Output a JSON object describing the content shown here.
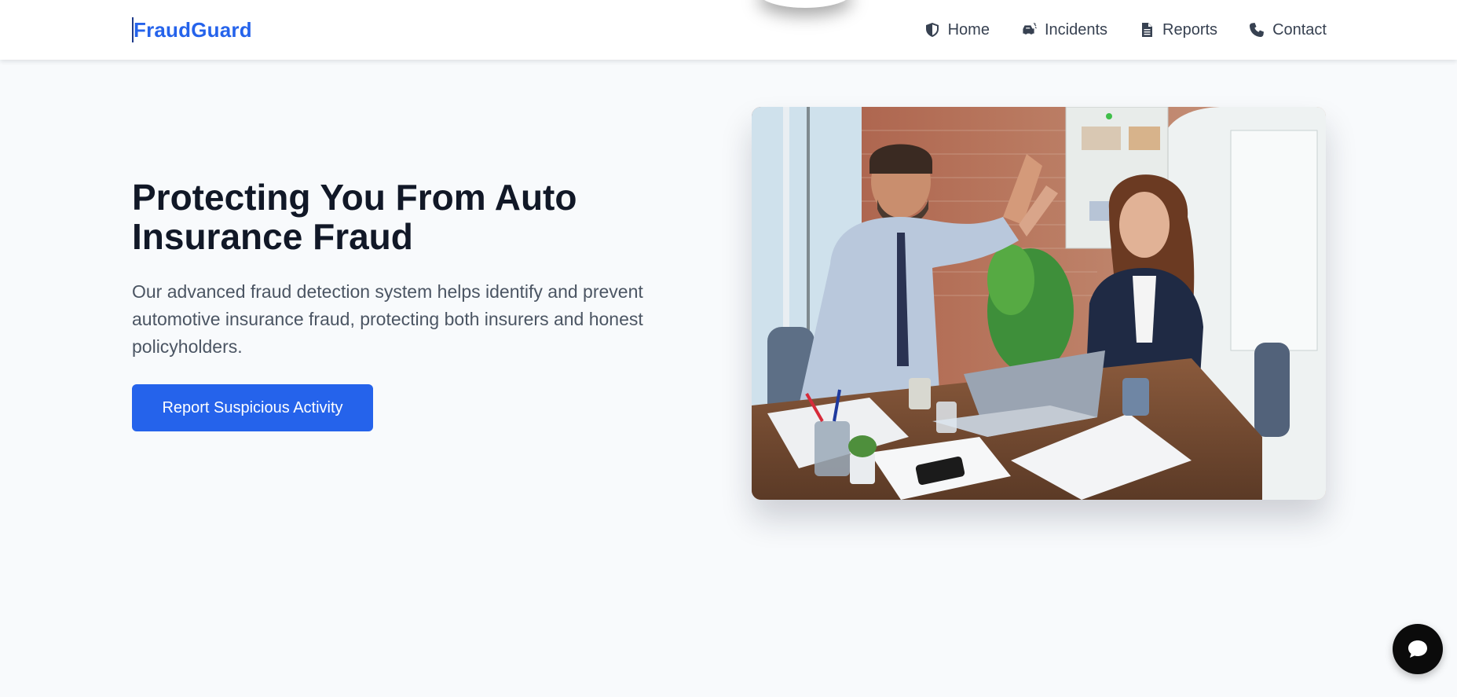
{
  "header": {
    "brand": "FraudGuard",
    "nav": [
      {
        "label": "Home",
        "icon": "shield-icon"
      },
      {
        "label": "Incidents",
        "icon": "car-crash-icon"
      },
      {
        "label": "Reports",
        "icon": "document-icon"
      },
      {
        "label": "Contact",
        "icon": "phone-icon"
      }
    ]
  },
  "hero": {
    "title": "Protecting You From Auto Insurance Fraud",
    "description": "Our advanced fraud detection system helps identify and prevent automotive insurance fraud, protecting both insurers and honest policyholders.",
    "cta_label": "Report Suspicious Activity",
    "image_icon": "office-high-five-photo"
  },
  "chat": {
    "icon": "chat-bubble-icon"
  },
  "colors": {
    "accent": "#2563eb",
    "text_dark": "#111827",
    "text_muted": "#4b5563",
    "page_bg": "#f8fafc"
  }
}
